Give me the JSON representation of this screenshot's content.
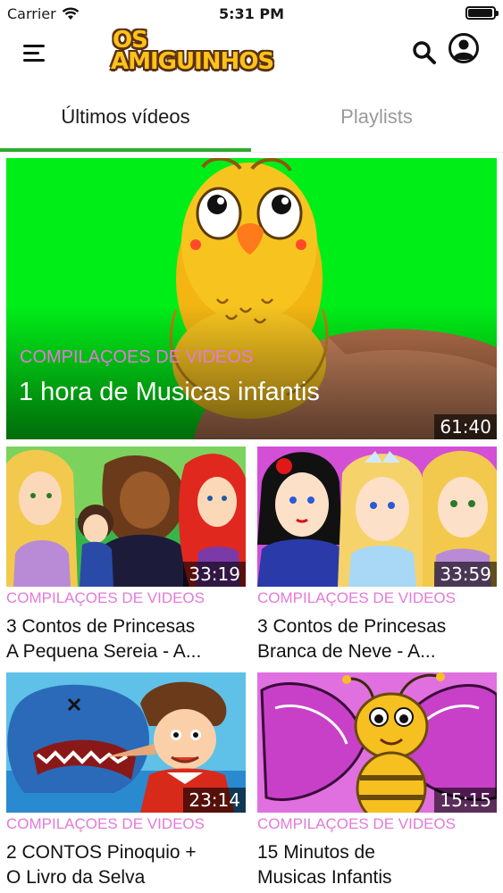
{
  "status_bar": {
    "carrier": "Carrier",
    "time": "5:31 PM",
    "battery_level": 0.95
  },
  "header": {
    "logo_line1": "OS",
    "logo_line2": "AMIGUINHOS",
    "menu_icon": "hamburger-menu-icon",
    "search_icon": "search-icon",
    "account_icon": "account-icon"
  },
  "tabs": [
    {
      "label": "Últimos vídeos",
      "active": true
    },
    {
      "label": "Playlists",
      "active": false
    }
  ],
  "colors": {
    "accent": "#2eaa2e",
    "category": "#e37ad9",
    "hero_bg": "#00ee18"
  },
  "featured": {
    "category": "COMPILAÇOES DE VIDEOS",
    "title": "1 hora de Musicas infantis",
    "duration": "61:40"
  },
  "videos": [
    {
      "category": "COMPILAÇOES DE VIDEOS",
      "title_line1": "3 Contos de Princesas",
      "title_line2": "A Pequena Sereia - A...",
      "duration": "33:19"
    },
    {
      "category": "COMPILAÇOES DE VIDEOS",
      "title_line1": "3 Contos de Princesas",
      "title_line2": "Branca de Neve -  A...",
      "duration": "33:59"
    },
    {
      "category": "COMPILAÇOES DE VIDEOS",
      "title_line1": "2 CONTOS  Pinoquio +",
      "title_line2": "O Livro da Selva",
      "duration": "23:14"
    },
    {
      "category": "COMPILAÇOES DE VIDEOS",
      "title_line1": "15 Minutos de",
      "title_line2": "Musicas Infantis",
      "duration": "15:15"
    }
  ]
}
